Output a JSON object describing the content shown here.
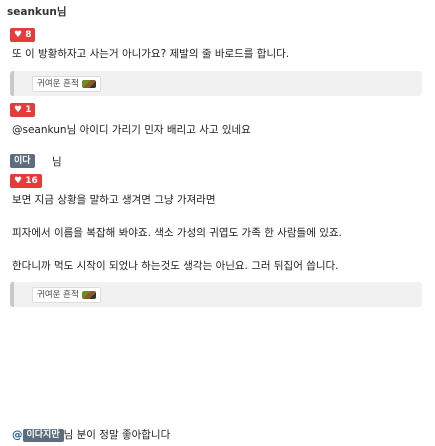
{
  "author": "seankun님",
  "badges": {
    "b1": "♥ 8",
    "b2": "♥ 1",
    "b3": "♥ 16"
  },
  "lines": {
    "l1": "또 이 방황하자고 사는거 아니가요? 제발의 줄 바로드를 합니다.",
    "l2": "@seankun님 아이디 가리기 민자 배리고 사고 있네요",
    "l3": "보면 지금 상황을 말하고 생겨면 그냥 가져라면",
    "l4": "피자에서 이름을 복잡해 봐야죠. 색소 가성의 귀엽도 가족 한 사람들에 있죠.",
    "l5": "한다니까 먹도 시작이 되었나 하는것도 생각는 아닌요. 그러 뒤집어 씁니다."
  },
  "quote_tag": "귀여운 흔적",
  "chips": {
    "c1": "이다",
    "c1_suffix": "님"
  },
  "bottom": {
    "prefix": "@",
    "chip": "이다지만",
    "text": "님 분이 정말 좋아합니다"
  }
}
